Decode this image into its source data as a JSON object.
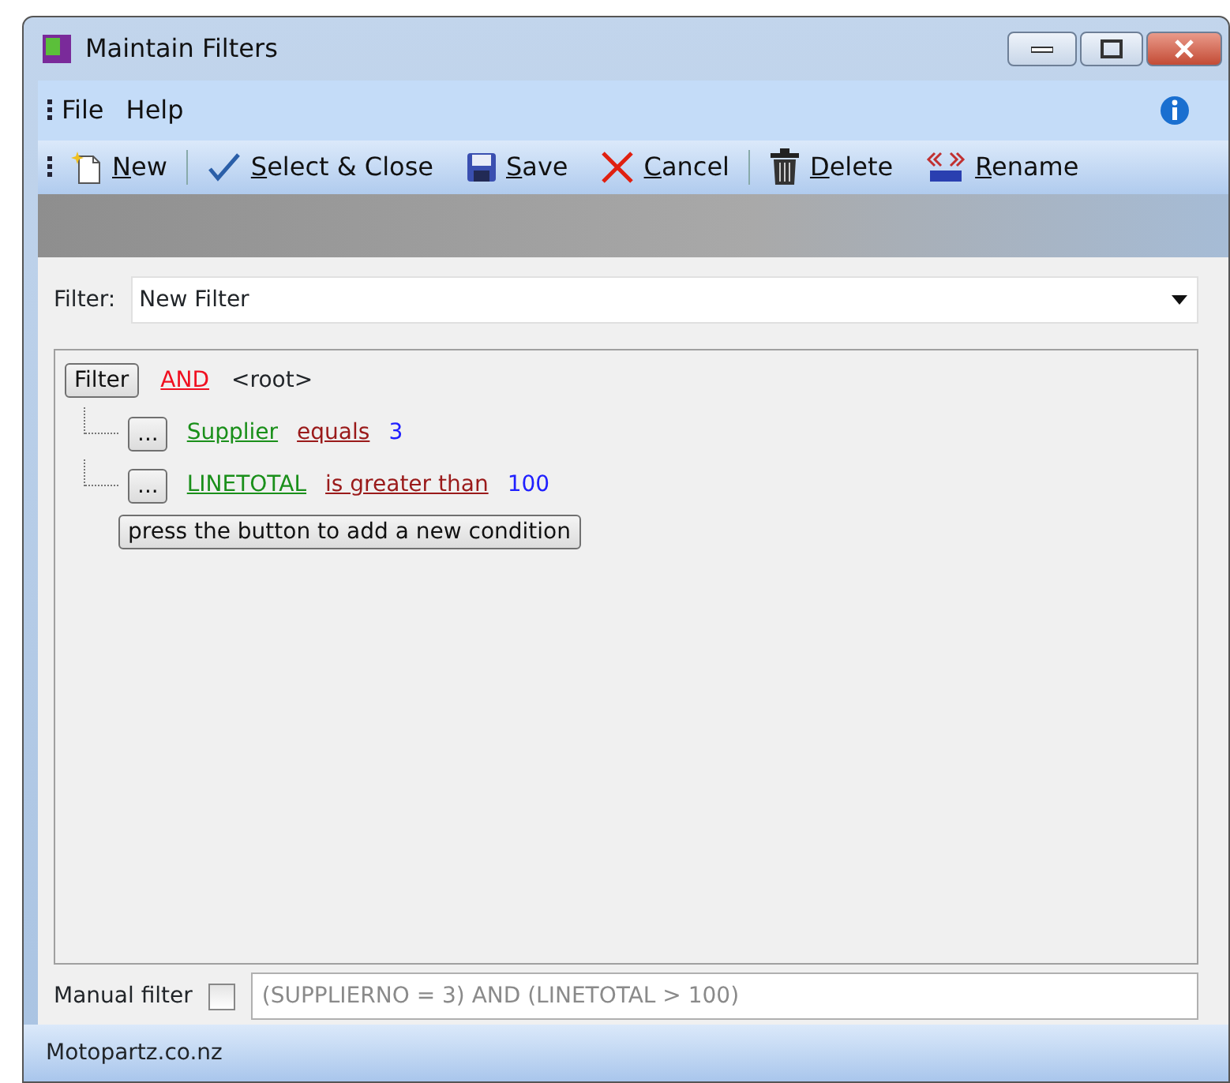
{
  "window": {
    "title": "Maintain Filters"
  },
  "menu": [
    "File",
    "Help"
  ],
  "toolbar": [
    {
      "kind": "new",
      "label": "New"
    },
    {
      "kind": "separator"
    },
    {
      "kind": "check",
      "label": "Select & Close"
    },
    {
      "kind": "save",
      "label": "Save"
    },
    {
      "kind": "cancel",
      "label": "Cancel"
    },
    {
      "kind": "separator"
    },
    {
      "kind": "delete",
      "label": "Delete"
    },
    {
      "kind": "rename",
      "label": "Rename"
    }
  ],
  "filter": {
    "label": "Filter:",
    "value": "New Filter"
  },
  "tree": {
    "button": "Filter",
    "operator": "AND",
    "node": "<root>",
    "conditions": [
      {
        "button": "...",
        "field": "Supplier",
        "operator": "equals",
        "value": "3"
      },
      {
        "button": "...",
        "field": "LINETOTAL",
        "operator": "is greater than",
        "value": "100"
      }
    ],
    "add_button": "press the button to add a new condition"
  },
  "manual_filter": {
    "label": "Manual filter",
    "checked": false,
    "value": "(SUPPLIERNO = 3) AND (LINETOTAL > 100)",
    "disabled": true
  },
  "status_bar": "Motopartz.co.nz"
}
